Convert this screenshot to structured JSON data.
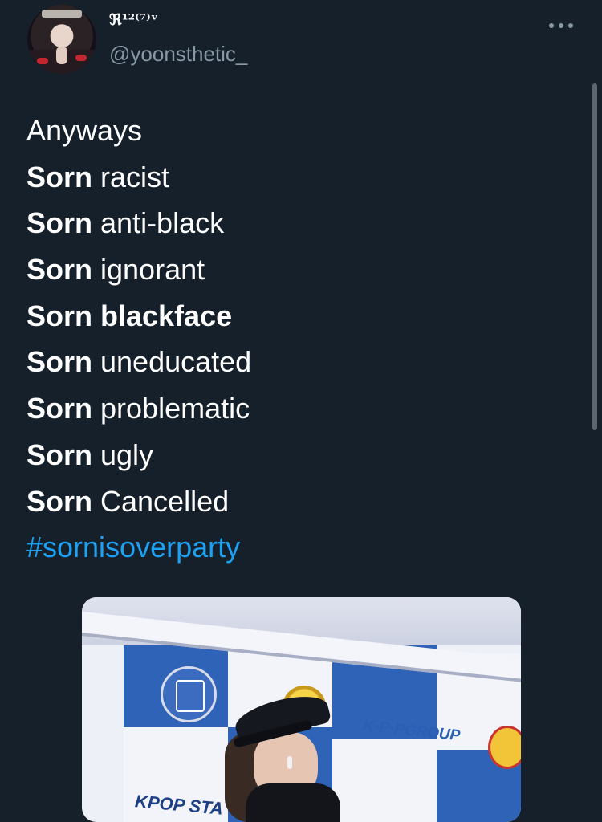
{
  "tweet": {
    "author": {
      "display_name": "ℜ¹²⁽⁷⁾ᵛ",
      "handle": "@yoonsthetic_"
    },
    "body_lines": [
      {
        "bold": "",
        "rest": "Anyways"
      },
      {
        "bold": "Sorn",
        "rest": " racist"
      },
      {
        "bold": "Sorn",
        "rest": " anti-black"
      },
      {
        "bold": "Sorn",
        "rest": " ignorant"
      },
      {
        "bold": "Sorn blackface",
        "rest": ""
      },
      {
        "bold": "Sorn",
        "rest": " uneducated"
      },
      {
        "bold": "Sorn",
        "rest": " problematic"
      },
      {
        "bold": "Sorn",
        "rest": " ugly"
      },
      {
        "bold": "Sorn",
        "rest": " Cancelled"
      }
    ],
    "hashtag": "#sornisoverparty",
    "media": {
      "logo_left": "KPOP STA",
      "logo_right": "K·P·PGROUP"
    }
  },
  "icons": {
    "more": "more-horizontal-icon"
  },
  "colors": {
    "background": "#15202b",
    "text": "#ffffff",
    "secondary_text": "#8899a6",
    "link": "#1da1f2"
  }
}
